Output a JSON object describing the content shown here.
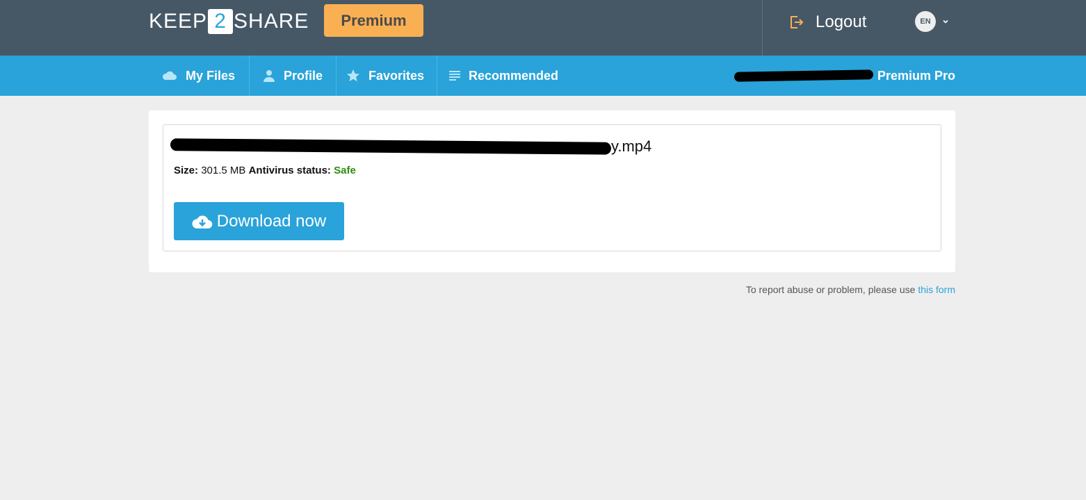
{
  "header": {
    "logo": {
      "left": "KEEP",
      "number": "2",
      "right": "SHARE"
    },
    "premium_label": "Premium",
    "logout_label": "Logout",
    "language": "EN"
  },
  "nav": {
    "items": [
      {
        "label": "My Files",
        "icon": "cloud-icon"
      },
      {
        "label": "Profile",
        "icon": "user-icon"
      },
      {
        "label": "Favorites",
        "icon": "star-icon"
      },
      {
        "label": "Recommended",
        "icon": "list-icon"
      }
    ],
    "account_type": "Premium Pro"
  },
  "file": {
    "name_suffix": "y.mp4",
    "size_label": "Size:",
    "size_value": "301.5 MB",
    "antivirus_label": "Antivirus status:",
    "antivirus_value": "Safe",
    "download_label": "Download now"
  },
  "footer": {
    "report_text": "To report abuse or problem, please use",
    "report_link": "this form"
  },
  "colors": {
    "header_bg": "#465866",
    "nav_bg": "#29a3d9",
    "premium": "#f9b053",
    "safe": "#2e8b0f",
    "page_bg": "#eeeeee"
  }
}
